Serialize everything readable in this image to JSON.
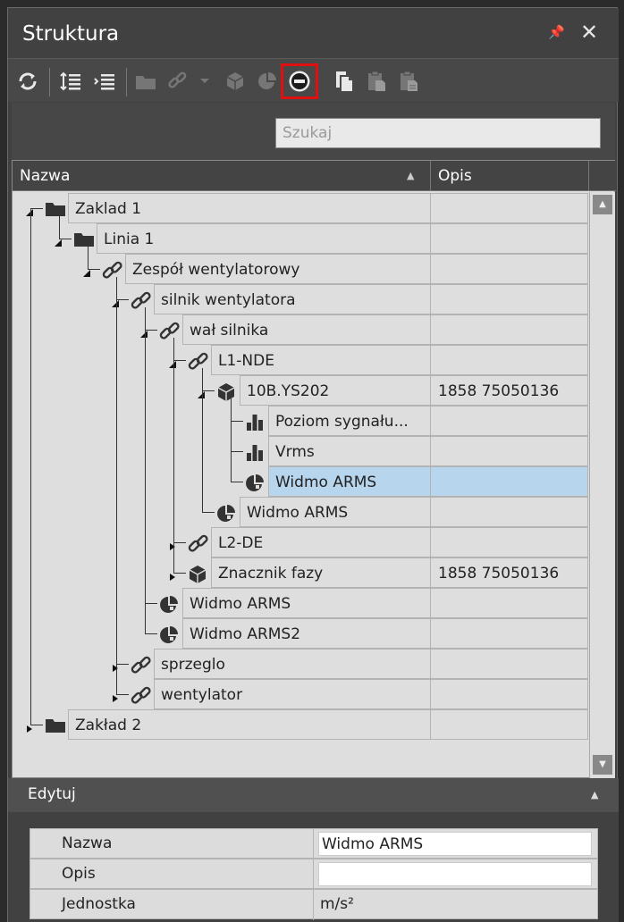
{
  "panel": {
    "title": "Struktura"
  },
  "toolbar": {
    "buttons": [
      "refresh-icon",
      "expand-all-icon",
      "collapse-all-icon",
      "folder-icon",
      "link-icon",
      "dropdown-arrow-icon",
      "cube-icon",
      "pie-icon",
      "remove-icon",
      "copy-icon",
      "paste-icon",
      "paste-special-icon"
    ],
    "highlight_color": "#e01010"
  },
  "search": {
    "placeholder": "Szukaj"
  },
  "grid": {
    "columns": {
      "name": "Nazwa",
      "desc": "Opis"
    },
    "rows": [
      {
        "name": "Zaklad 1",
        "desc": "",
        "icon": "folder-icon"
      },
      {
        "name": "Linia 1",
        "desc": "",
        "icon": "folder-icon"
      },
      {
        "name": "Zespół wentylatorowy",
        "desc": "",
        "icon": "link-icon"
      },
      {
        "name": "silnik wentylatora",
        "desc": "",
        "icon": "link-icon"
      },
      {
        "name": "wał silnika",
        "desc": "",
        "icon": "link-icon"
      },
      {
        "name": "L1-NDE",
        "desc": "",
        "icon": "link-icon"
      },
      {
        "name": "10B.YS202",
        "desc": "1858 75050136",
        "icon": "cube-icon"
      },
      {
        "name": "Poziom sygnału...",
        "desc": "",
        "icon": "bar-chart-icon"
      },
      {
        "name": "Vrms",
        "desc": "",
        "icon": "bar-chart-icon"
      },
      {
        "name": "Widmo ARMS",
        "desc": "",
        "icon": "pie-icon"
      },
      {
        "name": "Widmo ARMS",
        "desc": "",
        "icon": "pie-icon"
      },
      {
        "name": "L2-DE",
        "desc": "",
        "icon": "link-icon"
      },
      {
        "name": "Znacznik fazy",
        "desc": "1858 75050136",
        "icon": "cube-icon"
      },
      {
        "name": "Widmo ARMS",
        "desc": "",
        "icon": "pie-icon"
      },
      {
        "name": "Widmo ARMS2",
        "desc": "",
        "icon": "pie-icon"
      },
      {
        "name": "sprzeglo",
        "desc": "",
        "icon": "link-icon"
      },
      {
        "name": "wentylator",
        "desc": "",
        "icon": "link-icon"
      },
      {
        "name": "Zakład 2",
        "desc": "",
        "icon": "folder-icon"
      }
    ],
    "selected_row": 9,
    "selection_color": "#b8d5ee"
  },
  "edit": {
    "title": "Edytuj",
    "props": [
      {
        "label": "Nazwa",
        "value": "Widmo ARMS"
      },
      {
        "label": "Opis",
        "value": ""
      },
      {
        "label": "Jednostka",
        "value": "m/s²"
      }
    ]
  }
}
